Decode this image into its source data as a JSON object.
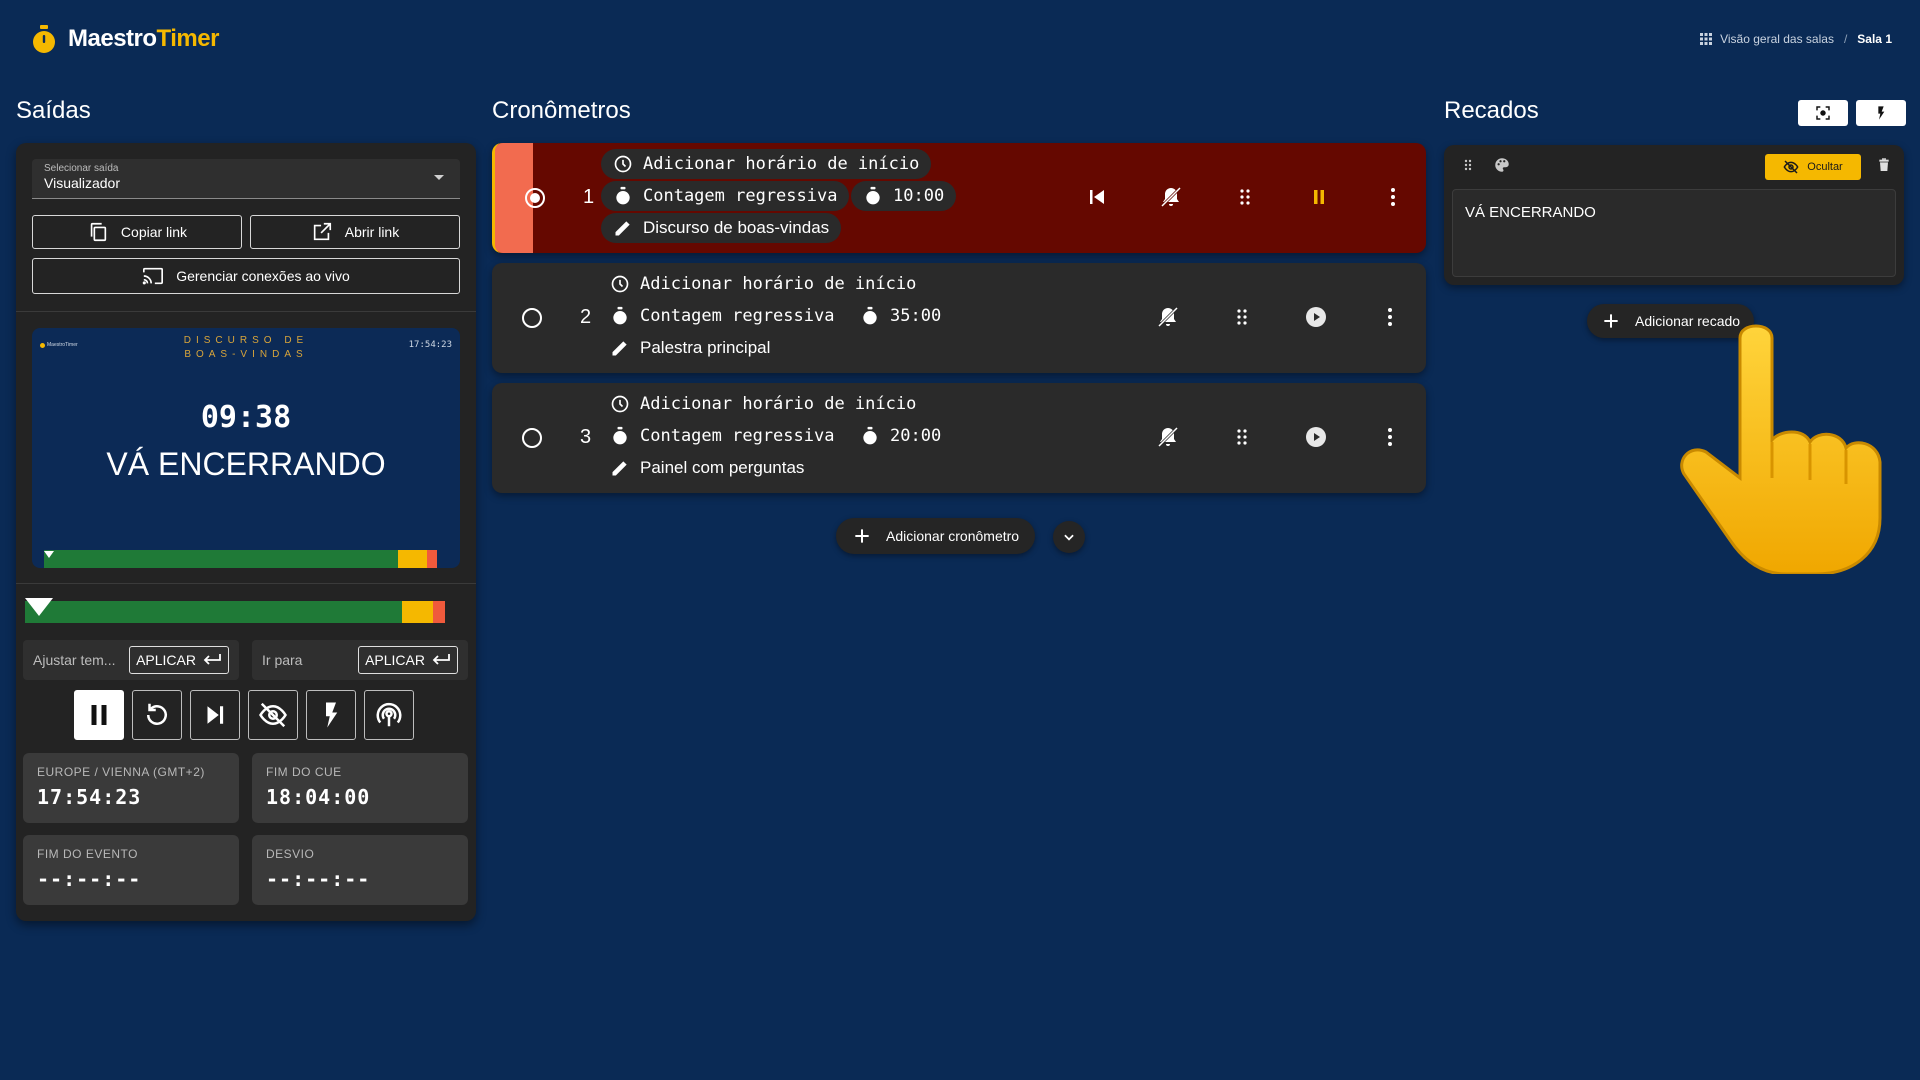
{
  "app": {
    "brand_left": "Maestro",
    "brand_right": "Timer"
  },
  "breadcrumb": {
    "overview": "Visão geral das salas",
    "separator": "/",
    "current": "Sala 1"
  },
  "colors": {
    "background": "#0a2a55",
    "accent": "#f5b800",
    "panel": "#232323",
    "active_row": "#650800",
    "active_band": "#f26b4f",
    "progress_green": "#1f7a37",
    "progress_yellow": "#f5b800",
    "progress_red": "#f05a3c"
  },
  "outputs": {
    "title": "Saídas",
    "select_label": "Selecionar saída",
    "select_value": "Visualizador",
    "copy_link": "Copiar link",
    "open_link": "Abrir link",
    "manage_connections": "Gerenciar conexões ao vivo",
    "preview": {
      "logo": "MaestroTimer",
      "title": "DISCURSO DE BOAS-VINDAS",
      "clock": "17:54:23",
      "timer": "09:38",
      "message": "VÁ ENCERRANDO"
    },
    "progress": {
      "elapsed_fraction": 0.04,
      "green_fraction": 0.85,
      "yellow_fraction": 0.07,
      "red_fraction": 0.025
    },
    "adjust_placeholder": "Ajustar tem...",
    "goto_placeholder": "Ir para",
    "apply_label": "APLICAR",
    "controls": [
      "pause-icon",
      "restart-icon",
      "skip-next-icon",
      "hide-icon",
      "flash-icon",
      "broadcast-icon"
    ],
    "tiles": {
      "timezone_label": "EUROPE / VIENNA (GMT+2)",
      "timezone_value": "17:54:23",
      "cue_end_label": "FIM DO CUE",
      "cue_end_value": "18:04:00",
      "event_end_label": "FIM DO EVENTO",
      "event_end_value": "--:--:--",
      "deviation_label": "DESVIO",
      "deviation_value": "--:--:--"
    }
  },
  "timers": {
    "title": "Cronômetros",
    "add_start_time": "Adicionar horário de início",
    "countdown": "Contagem regressiva",
    "rows": [
      {
        "number": "1",
        "duration": "10:00",
        "name": "Discurso de boas-vindas",
        "active": true
      },
      {
        "number": "2",
        "duration": "35:00",
        "name": "Palestra principal",
        "active": false
      },
      {
        "number": "3",
        "duration": "20:00",
        "name": "Painel com perguntas",
        "active": false
      }
    ],
    "add_timer": "Adicionar cronômetro"
  },
  "messages": {
    "title": "Recados",
    "hide_label": "Ocultar",
    "message_text": "VÁ ENCERRANDO",
    "add_message": "Adicionar recado"
  }
}
